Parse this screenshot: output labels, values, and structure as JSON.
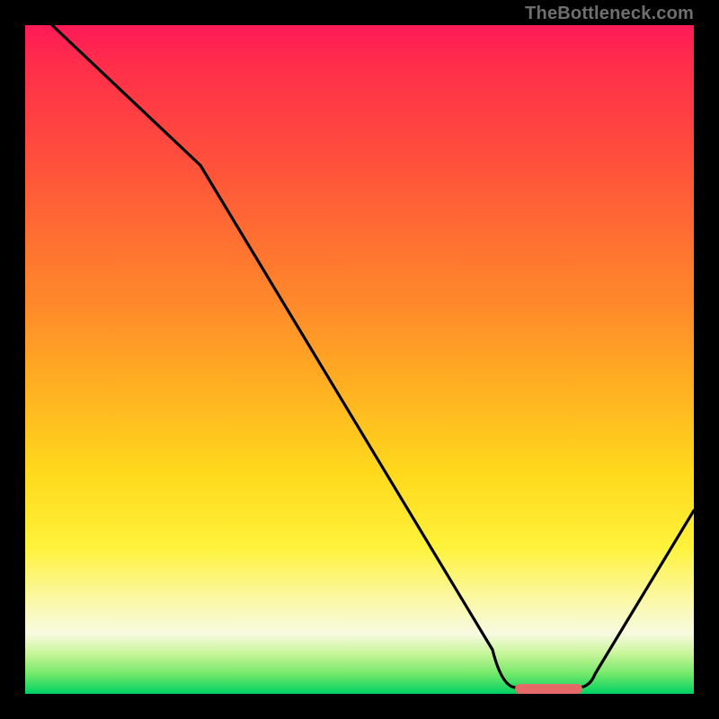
{
  "watermark": "TheBottleneck.com",
  "chart_data": {
    "type": "line",
    "title": "",
    "xlabel": "",
    "ylabel": "",
    "xlim": [
      0,
      100
    ],
    "ylim": [
      0,
      100
    ],
    "x": [
      0,
      4,
      26,
      70,
      73,
      83,
      85,
      100
    ],
    "values": [
      110,
      100,
      79,
      6,
      1,
      1,
      3,
      27
    ],
    "marker": {
      "x_range": [
        73,
        83
      ],
      "y": 0.6,
      "color": "#e46a6a",
      "shape": "rounded-bar"
    },
    "background_gradient": {
      "direction": "vertical",
      "stops": [
        {
          "pos": 0.0,
          "color": "#ff1a57"
        },
        {
          "pos": 0.3,
          "color": "#ff6a33"
        },
        {
          "pos": 0.67,
          "color": "#ffd91c"
        },
        {
          "pos": 0.91,
          "color": "#f7fae0"
        },
        {
          "pos": 1.0,
          "color": "#00d163"
        }
      ]
    }
  }
}
